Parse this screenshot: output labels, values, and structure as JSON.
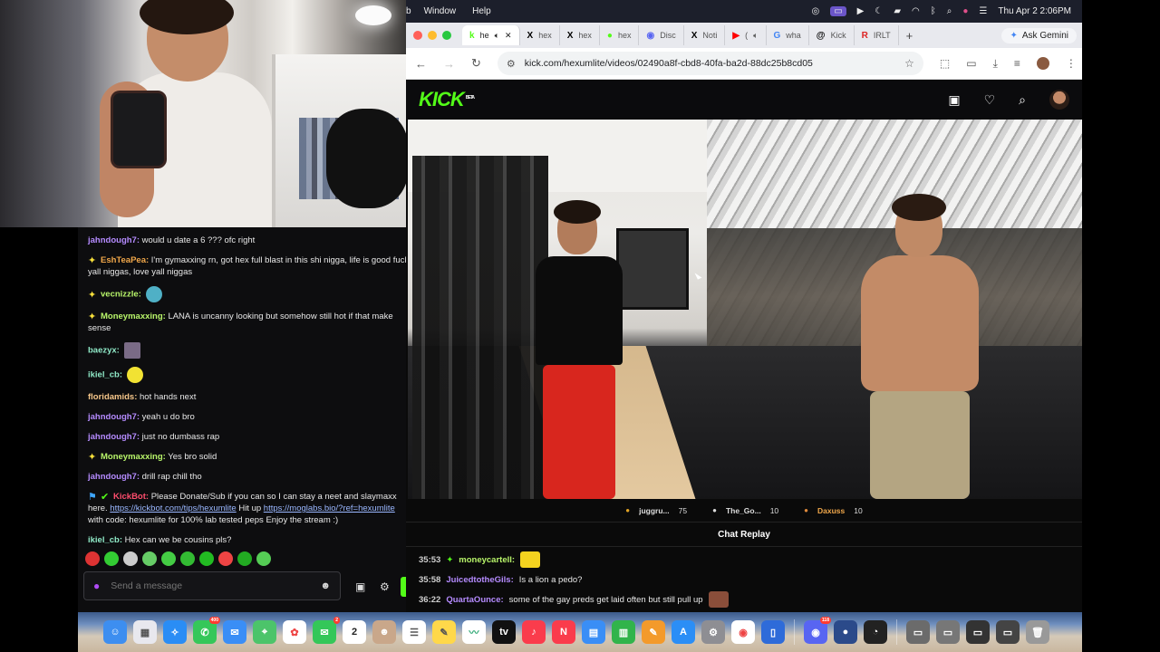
{
  "menubar": {
    "app_items": [
      "Window",
      "Help"
    ],
    "datetime": "Thu Apr 2  2:06PM"
  },
  "browser": {
    "tabs": [
      {
        "label": "he",
        "icon": "kick-icon",
        "active": true
      },
      {
        "label": "hex",
        "icon": "x-icon"
      },
      {
        "label": "hex",
        "icon": "x-icon"
      },
      {
        "label": "hex",
        "icon": "kick-icon"
      },
      {
        "label": "Disc",
        "icon": "discord-icon"
      },
      {
        "label": "Noti",
        "icon": "x-icon"
      },
      {
        "label": "(",
        "icon": "youtube-icon"
      },
      {
        "label": "wha",
        "icon": "google-icon"
      },
      {
        "label": "Kick",
        "icon": "threads-icon"
      },
      {
        "label": "IRLT",
        "icon": "irl-icon"
      }
    ],
    "ask_gemini": "Ask Gemini",
    "url": "kick.com/hexumlite/videos/02490a8f-cbd8-40fa-ba2d-88dc25b8cd05"
  },
  "kick": {
    "logo": "KICK",
    "logo_beta": "BETA"
  },
  "leaderboard": [
    {
      "name": "juggru...",
      "score": "75"
    },
    {
      "name": "The_Go...",
      "score": "10"
    },
    {
      "name": "Daxuss",
      "score": "10"
    }
  ],
  "chat_replay": {
    "title": "Chat Replay",
    "messages": [
      {
        "time": "35:53",
        "user": "moneycartell:",
        "text": "",
        "user_color": "#b8f56a"
      },
      {
        "time": "35:58",
        "user": "JuicedtotheGils:",
        "text": "Is a lion a pedo?",
        "user_color": "#b58bff"
      },
      {
        "time": "36:22",
        "user": "QuartaOunce:",
        "text": "some of the gay preds get laid often but still pull up",
        "user_color": "#b58bff"
      }
    ]
  },
  "left_chat": {
    "messages": [
      {
        "user": "jahndough7:",
        "text": "would u date a 6 ??? ofc right",
        "color": "#b58bff"
      },
      {
        "user": "EshTeaPea:",
        "text": "I'm gymaxxing rn, got hex full blast in this shi nigga, life is good fuck yall niggas, love yall niggas",
        "color": "#f0a74a"
      },
      {
        "user": "vecnizzle:",
        "text": "",
        "color": "#b8f56a"
      },
      {
        "user": "Moneymaxxing:",
        "text": "LANA is uncanny looking but somehow still hot if that make sense",
        "color": "#b8f56a"
      },
      {
        "user": "baezyx:",
        "text": "",
        "color": "#8fe9c7"
      },
      {
        "user": "ikiel_cb:",
        "text": "",
        "color": "#8fe9c7"
      },
      {
        "user": "floridamids:",
        "text": "hot hands next",
        "color": "#f7c78a"
      },
      {
        "user": "jahndough7:",
        "text": "yeah u do bro",
        "color": "#b58bff"
      },
      {
        "user": "jahndough7:",
        "text": "just no dumbass rap",
        "color": "#b58bff"
      },
      {
        "user": "Moneymaxxing:",
        "text": "Yes bro solid",
        "color": "#b8f56a"
      },
      {
        "user": "jahndough7:",
        "text": "drill rap chill tho",
        "color": "#b58bff"
      },
      {
        "user": "ikiel_cb:",
        "text": "Hex can we be cousins pls?",
        "color": "#8fe9c7"
      }
    ],
    "kickbot": {
      "user": "KickBot:",
      "text_1": "Please Donate/Sub if you can so I can stay a neet and slaymaxx here.",
      "link_1": "https://kickbot.com/tips/hexumlite",
      "text_2": "Hit up",
      "link_2": "https://moglabs.bio/?ref=hexumlite",
      "text_3": "with code: hexumlite for 100% lab tested peps Enjoy the stream :)"
    },
    "input_placeholder": "Send a message"
  },
  "dock": {
    "badges": {
      "whatsapp": "400",
      "messages": "2",
      "discord": "118"
    },
    "calendar_day": "2"
  }
}
